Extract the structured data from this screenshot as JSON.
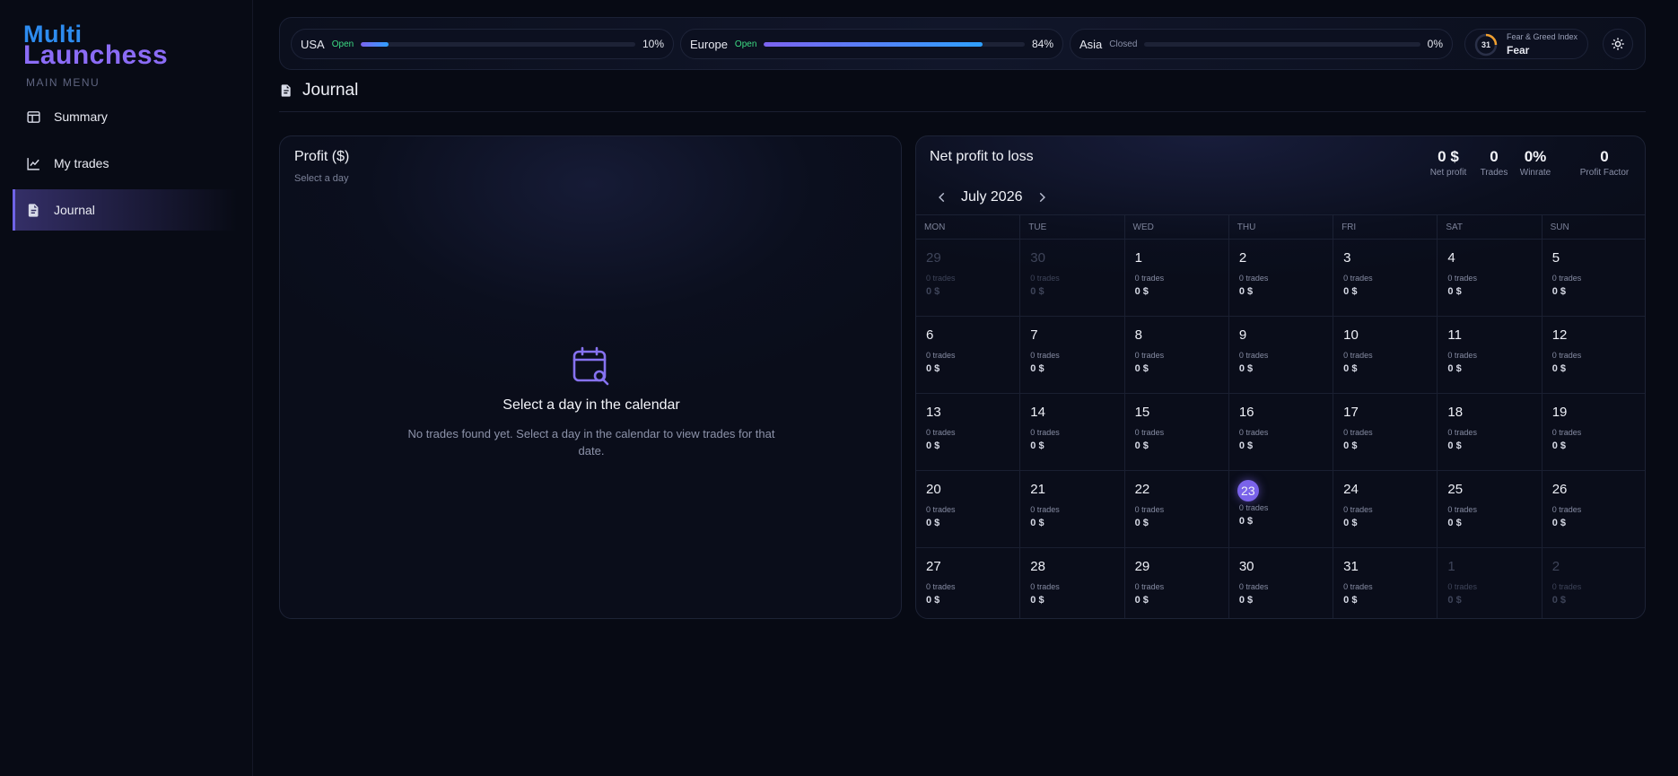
{
  "brand": {
    "line1": "Multi",
    "line2": "Launchess"
  },
  "sidebar": {
    "heading": "MAIN MENU",
    "items": [
      {
        "label": "Summary",
        "icon": "layout-icon"
      },
      {
        "label": "My trades",
        "icon": "chart-line-icon"
      },
      {
        "label": "Journal",
        "icon": "document-icon",
        "active": true
      }
    ]
  },
  "markets": [
    {
      "name": "USA",
      "status": "Open",
      "progress": 10,
      "pct_label": "10%"
    },
    {
      "name": "Europe",
      "status": "Open",
      "progress": 84,
      "pct_label": "84%"
    },
    {
      "name": "Asia",
      "status": "Closed",
      "progress": 0,
      "pct_label": "0%"
    }
  ],
  "fear_greed": {
    "title": "Fear & Greed Index",
    "value": "31",
    "label": "Fear"
  },
  "page": {
    "title": "Journal"
  },
  "profit_panel": {
    "title": "Profit ($)",
    "subtitle": "Select a day",
    "empty_title": "Select a day in the calendar",
    "empty_desc": "No trades found yet. Select a day in the calendar to view trades for that date."
  },
  "calendar": {
    "title": "Net profit to loss",
    "month": "July 2026",
    "stats": [
      {
        "value": "0 $",
        "label": "Net profit"
      },
      {
        "value": "0",
        "label": "Trades"
      },
      {
        "value": "0%",
        "label": "Winrate"
      },
      {
        "value": "0",
        "label": "Profit Factor"
      }
    ],
    "weekdays": [
      "MON",
      "TUE",
      "WED",
      "THU",
      "FRI",
      "SAT",
      "SUN"
    ],
    "today": "23",
    "days": [
      {
        "d": "29",
        "muted": true,
        "t": "0 trades",
        "p": "0 $"
      },
      {
        "d": "30",
        "muted": true,
        "t": "0 trades",
        "p": "0 $"
      },
      {
        "d": "1",
        "t": "0 trades",
        "p": "0 $"
      },
      {
        "d": "2",
        "t": "0 trades",
        "p": "0 $"
      },
      {
        "d": "3",
        "t": "0 trades",
        "p": "0 $"
      },
      {
        "d": "4",
        "t": "0 trades",
        "p": "0 $"
      },
      {
        "d": "5",
        "t": "0 trades",
        "p": "0 $"
      },
      {
        "d": "6",
        "t": "0 trades",
        "p": "0 $"
      },
      {
        "d": "7",
        "t": "0 trades",
        "p": "0 $"
      },
      {
        "d": "8",
        "t": "0 trades",
        "p": "0 $"
      },
      {
        "d": "9",
        "t": "0 trades",
        "p": "0 $"
      },
      {
        "d": "10",
        "t": "0 trades",
        "p": "0 $"
      },
      {
        "d": "11",
        "t": "0 trades",
        "p": "0 $"
      },
      {
        "d": "12",
        "t": "0 trades",
        "p": "0 $"
      },
      {
        "d": "13",
        "t": "0 trades",
        "p": "0 $"
      },
      {
        "d": "14",
        "t": "0 trades",
        "p": "0 $"
      },
      {
        "d": "15",
        "t": "0 trades",
        "p": "0 $"
      },
      {
        "d": "16",
        "t": "0 trades",
        "p": "0 $"
      },
      {
        "d": "17",
        "t": "0 trades",
        "p": "0 $"
      },
      {
        "d": "18",
        "t": "0 trades",
        "p": "0 $"
      },
      {
        "d": "19",
        "t": "0 trades",
        "p": "0 $"
      },
      {
        "d": "20",
        "t": "0 trades",
        "p": "0 $"
      },
      {
        "d": "21",
        "t": "0 trades",
        "p": "0 $"
      },
      {
        "d": "22",
        "t": "0 trades",
        "p": "0 $"
      },
      {
        "d": "23",
        "t": "0 trades",
        "p": "0 $"
      },
      {
        "d": "24",
        "t": "0 trades",
        "p": "0 $"
      },
      {
        "d": "25",
        "t": "0 trades",
        "p": "0 $"
      },
      {
        "d": "26",
        "t": "0 trades",
        "p": "0 $"
      },
      {
        "d": "27",
        "t": "0 trades",
        "p": "0 $"
      },
      {
        "d": "28",
        "t": "0 trades",
        "p": "0 $"
      },
      {
        "d": "29",
        "t": "0 trades",
        "p": "0 $"
      },
      {
        "d": "30",
        "t": "0 trades",
        "p": "0 $"
      },
      {
        "d": "31",
        "t": "0 trades",
        "p": "0 $"
      },
      {
        "d": "1",
        "muted": true,
        "t": "0 trades",
        "p": "0 $"
      },
      {
        "d": "2",
        "muted": true,
        "t": "0 trades",
        "p": "0 $"
      }
    ]
  },
  "colors": {
    "accent": "#7a63ea",
    "open": "#3ddc84",
    "brand_blue": "#2d8cf0"
  }
}
